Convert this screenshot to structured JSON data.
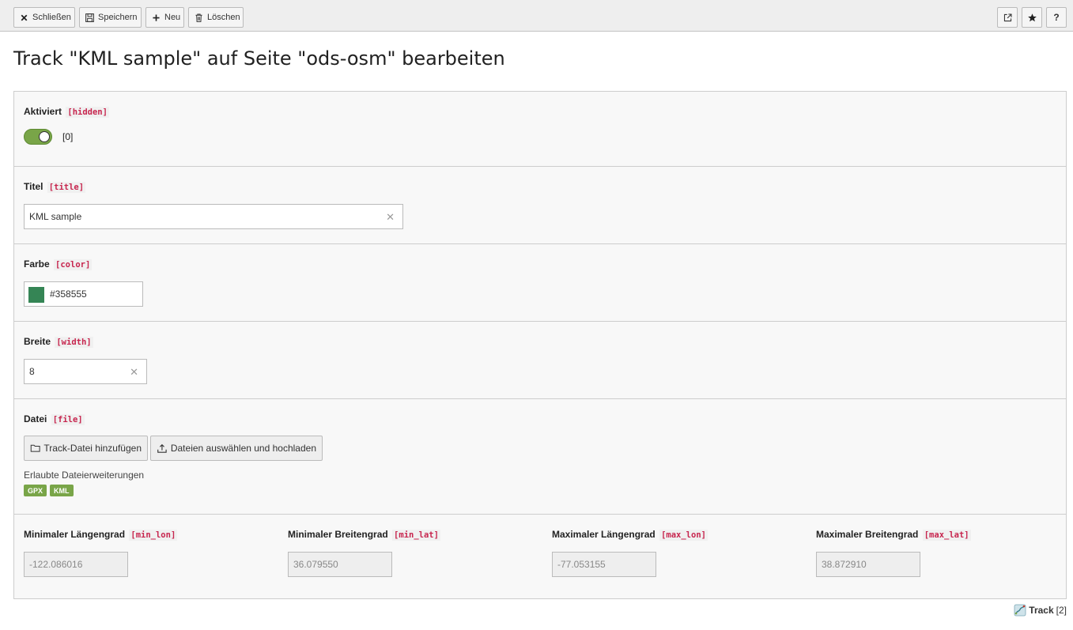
{
  "toolbar": {
    "close_label": "Schließen",
    "save_label": "Speichern",
    "new_label": "Neu",
    "delete_label": "Löschen",
    "help_label": "?"
  },
  "page_title": "Track \"KML sample\" auf Seite \"ods-osm\" bearbeiten",
  "fields": {
    "hidden": {
      "label": "Aktiviert",
      "field": "[hidden]",
      "toggle_on": true,
      "toggle_value": "[0]"
    },
    "title": {
      "label": "Titel",
      "field": "[title]",
      "value": "KML sample"
    },
    "color": {
      "label": "Farbe",
      "field": "[color]",
      "value": "#358555",
      "swatch": "#358555"
    },
    "width": {
      "label": "Breite",
      "field": "[width]",
      "value": "8"
    },
    "file": {
      "label": "Datei",
      "field": "[file]",
      "add_button": "Track-Datei hinzufügen",
      "upload_button": "Dateien auswählen und hochladen",
      "allowed_label": "Erlaubte Dateierweiterungen",
      "extensions": [
        "GPX",
        "KML"
      ]
    },
    "bounds": [
      {
        "label": "Minimaler Längengrad",
        "field": "[min_lon]",
        "value": "-122.086016"
      },
      {
        "label": "Minimaler Breitengrad",
        "field": "[min_lat]",
        "value": "36.079550"
      },
      {
        "label": "Maximaler Längengrad",
        "field": "[max_lon]",
        "value": "-77.053155"
      },
      {
        "label": "Maximaler Breitengrad",
        "field": "[max_lat]",
        "value": "38.872910"
      }
    ]
  },
  "footer": {
    "record_type": "Track",
    "record_uid": "[2]"
  },
  "colors": {
    "accent": "#79a548",
    "field_code": "#c7254e"
  }
}
